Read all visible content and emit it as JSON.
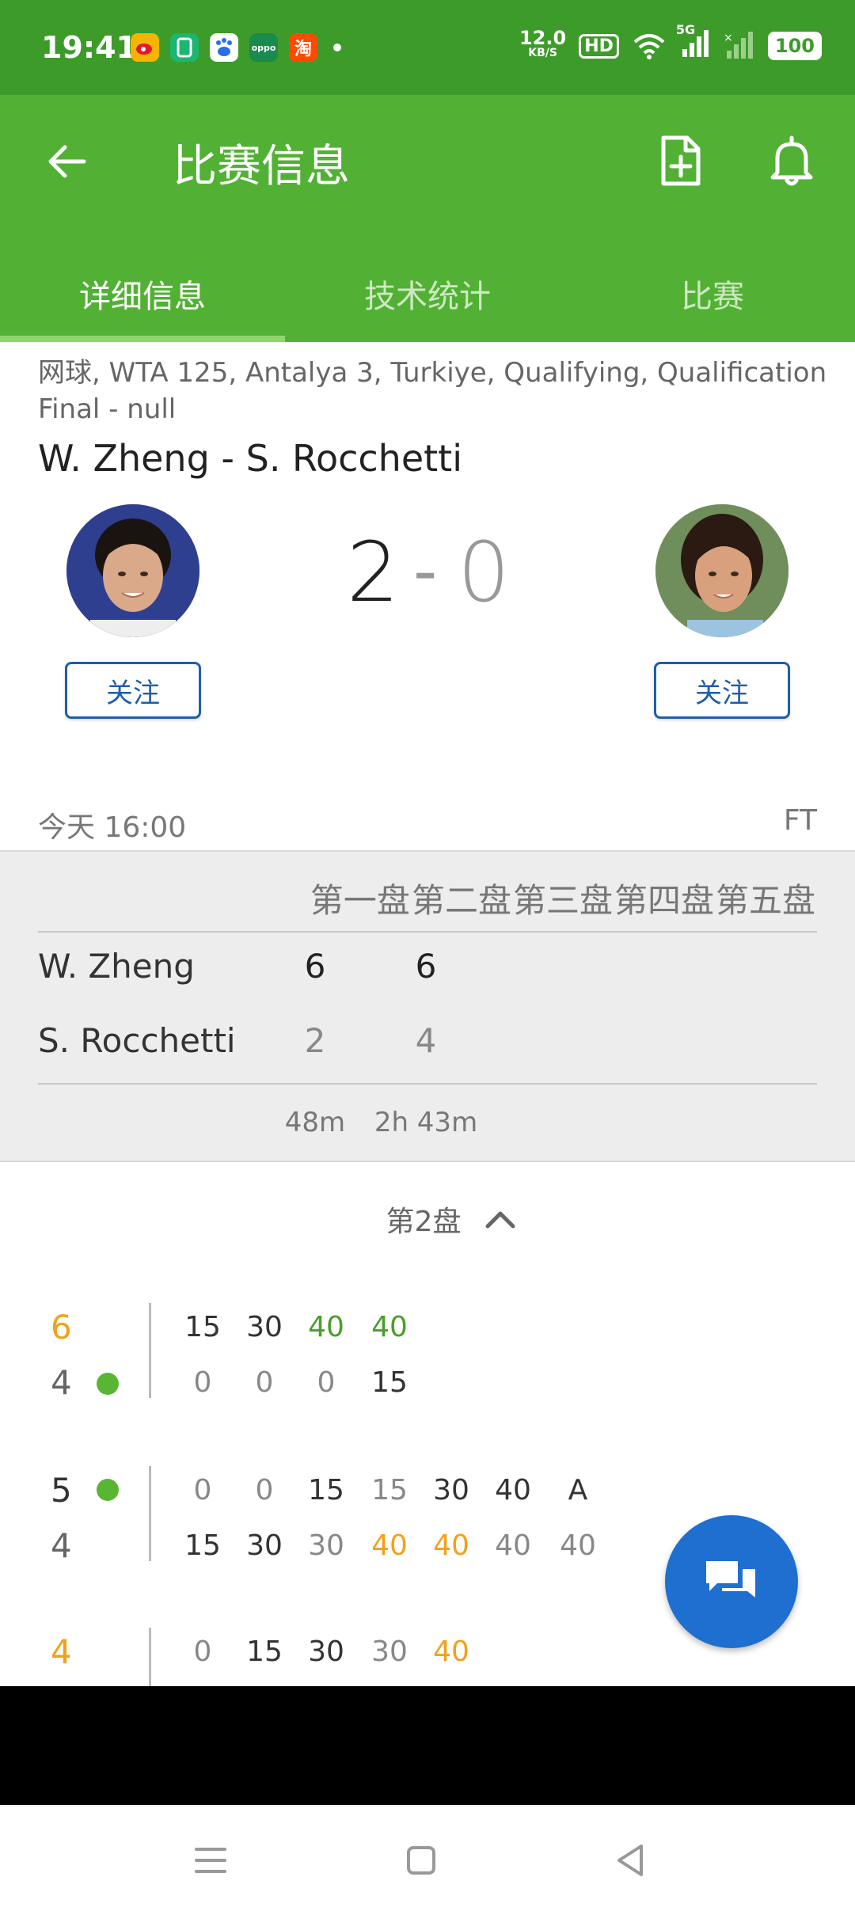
{
  "status_bar": {
    "time": "19:41",
    "net_speed_value": "12.0",
    "net_speed_unit": "KB/S",
    "hd_label": "HD",
    "network_label": "5G",
    "battery": "100",
    "apps": [
      {
        "name": "weibo-icon",
        "glyph": "微",
        "color": "#e6162d"
      },
      {
        "name": "wallet-icon",
        "glyph": "▯",
        "color": "#1bb66f"
      },
      {
        "name": "baidu-icon",
        "glyph": "du",
        "color": "#2b6de5"
      },
      {
        "name": "oppo-icon",
        "glyph": "oppo",
        "color": "#1a8b4f"
      },
      {
        "name": "taobao-icon",
        "glyph": "淘",
        "color": "#ff4a00"
      }
    ]
  },
  "app_bar": {
    "title": "比赛信息",
    "tabs": [
      {
        "label": "详细信息",
        "active": true
      },
      {
        "label": "技术统计",
        "active": false
      },
      {
        "label": "比赛",
        "active": false
      }
    ]
  },
  "match": {
    "league": "网球, WTA 125, Antalya 3, Turkiye, Qualifying, Qualification Final - null",
    "title": "W. Zheng - S. Rocchetti",
    "home_score": "2",
    "separator": "-",
    "away_score": "0",
    "follow_label": "关注",
    "time": "今天 16:00",
    "status": "FT"
  },
  "set_table": {
    "headers": [
      "第一盘",
      "第二盘",
      "第三盘",
      "第四盘",
      "第五盘"
    ],
    "rows": [
      {
        "name": "W. Zheng",
        "sets": [
          "6",
          "6"
        ]
      },
      {
        "name": "S. Rocchetti",
        "sets": [
          "2",
          "4"
        ]
      }
    ],
    "durations": [
      "48m",
      "2h 43m"
    ]
  },
  "set_detail": {
    "label": "第2盘",
    "games": [
      {
        "top_score": "6",
        "bottom_score": "4",
        "server": "bottom",
        "top_points": [
          "15",
          "30",
          "40",
          "40"
        ],
        "bottom_points": [
          "0",
          "0",
          "0",
          "15"
        ]
      },
      {
        "top_score": "5",
        "bottom_score": "4",
        "server": "top",
        "top_points": [
          "0",
          "0",
          "15",
          "15",
          "30",
          "40",
          "A"
        ],
        "bottom_points": [
          "15",
          "30",
          "30",
          "40",
          "40",
          "40",
          "40"
        ]
      },
      {
        "top_score": "4",
        "bottom_score": "",
        "server": "none",
        "top_points": [
          "0",
          "15",
          "30",
          "30",
          "40"
        ],
        "bottom_points": []
      }
    ]
  },
  "colors": {
    "status_bar": "#3d9b2a",
    "app_bar": "#52b135",
    "accent_blue": "#1f5ea8",
    "fab": "#1e6fd0",
    "orange": "#f0a21b",
    "green_points": "#4a9e2b"
  }
}
